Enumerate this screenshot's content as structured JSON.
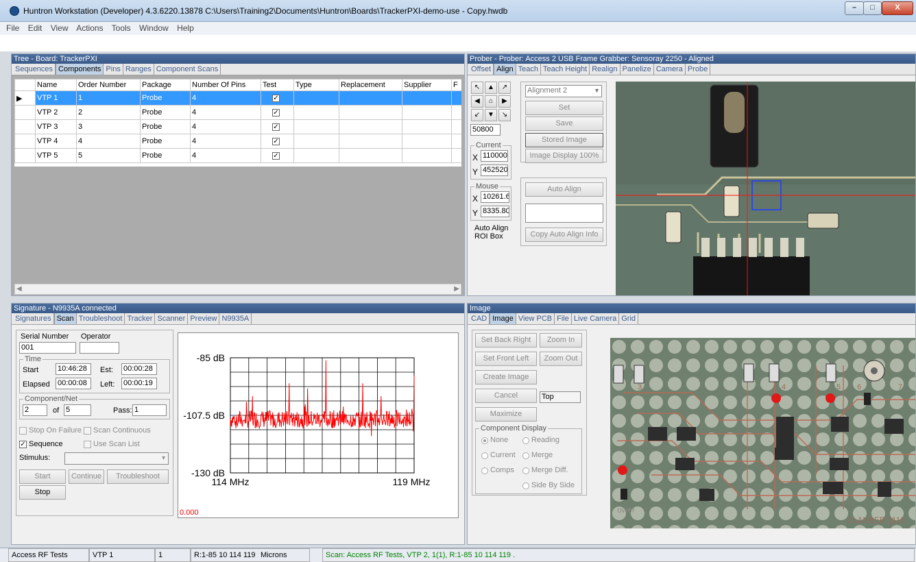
{
  "title": "Huntron Workstation (Developer) 4.3.6220.13878  C:\\Users\\Training2\\Documents\\Huntron\\Boards\\TrackerPXI-demo-use - Copy.hwdb",
  "window_buttons": {
    "minimize": "–",
    "maximize": "□",
    "close": "X"
  },
  "menu": [
    "File",
    "Edit",
    "View",
    "Actions",
    "Tools",
    "Window",
    "Help"
  ],
  "tree": {
    "title": "Tree - Board: TrackerPXI",
    "tabs": [
      "Sequences",
      "Components",
      "Pins",
      "Ranges",
      "Component Scans"
    ],
    "active_tab": 1,
    "columns": [
      "Name",
      "Order Number",
      "Package",
      "Number Of Pins",
      "Test",
      "Type",
      "Replacement",
      "Supplier",
      "F"
    ],
    "rows": [
      {
        "name": "VTP 1",
        "order": "1",
        "package": "Probe",
        "pins": "4",
        "test": true,
        "selected": true
      },
      {
        "name": "VTP 2",
        "order": "2",
        "package": "Probe",
        "pins": "4",
        "test": true
      },
      {
        "name": "VTP 3",
        "order": "3",
        "package": "Probe",
        "pins": "4",
        "test": true
      },
      {
        "name": "VTP 4",
        "order": "4",
        "package": "Probe",
        "pins": "4",
        "test": true
      },
      {
        "name": "VTP 5",
        "order": "5",
        "package": "Probe",
        "pins": "4",
        "test": true
      }
    ]
  },
  "prober": {
    "title": "Prober - Prober: Access 2 USB Frame Grabber: Sensoray 2250 - Aligned",
    "tabs": [
      "Offset",
      "Align",
      "Teach",
      "Teach Height",
      "Realign",
      "Panelize",
      "Camera",
      "Probe"
    ],
    "active_tab": 1,
    "step": "50800",
    "current_label": "Current",
    "current_x": "110000",
    "current_y": "452520",
    "mouse_label": "Mouse",
    "mouse_x": "10261.6",
    "mouse_y": "8335.803",
    "roi_label": "Auto Align ROI Box",
    "alignment": "Alignment 2",
    "buttons": {
      "set": "Set",
      "save": "Save",
      "stored_image": "Stored Image",
      "image_display": "Image Display 100%",
      "auto_align": "Auto Align",
      "copy_auto_align": "Copy Auto Align Info"
    }
  },
  "signature": {
    "title": "Signature - N9935A connected",
    "tabs": [
      "Signatures",
      "Scan",
      "Troubleshoot",
      "Tracker",
      "Scanner",
      "Preview",
      "N9935A"
    ],
    "active_tab": 1,
    "serial_label": "Serial Number",
    "serial": "001",
    "operator_label": "Operator",
    "operator": "",
    "time_label": "Time",
    "start_label": "Start",
    "start": "10:46:28",
    "est_label": "Est:",
    "est": "00:00:28",
    "elapsed_label": "Elapsed",
    "elapsed": "00:00:08",
    "left_label": "Left:",
    "left": "00:00:19",
    "component_label": "Component/Net",
    "comp_index": "2",
    "of_label": "of",
    "comp_total": "5",
    "pass_label": "Pass:",
    "pass": "1",
    "stop_on_failure": "Stop On Failure",
    "scan_continuous": "Scan Continuous",
    "sequence": "Sequence",
    "use_scan_list": "Use Scan List",
    "stimulus_label": "Stimulus:",
    "buttons": {
      "start": "Start",
      "continue": "Continue",
      "troubleshoot": "Troubleshoot",
      "stop": "Stop"
    },
    "readout": "0.000"
  },
  "chart_data": {
    "type": "line",
    "ytick_labels": [
      "-85 dB",
      "-107.5 dB",
      "-130 dB"
    ],
    "xtick_labels": [
      "114 MHz",
      "119 MHz"
    ],
    "x_range": [
      114,
      119
    ],
    "y_range": [
      -130,
      -85
    ],
    "grid": true,
    "series": [
      {
        "color": "#ff0000",
        "noise_floor_db": -109,
        "peaks": [
          {
            "x": 114.6,
            "y": -100
          },
          {
            "x": 115.6,
            "y": -95
          },
          {
            "x": 116.1,
            "y": -97
          },
          {
            "x": 116.6,
            "y": -86
          },
          {
            "x": 117.6,
            "y": -95
          },
          {
            "x": 118.1,
            "y": -100
          },
          {
            "x": 119.0,
            "y": -92
          }
        ]
      }
    ]
  },
  "image_pane": {
    "title": "Image",
    "tabs": [
      "CAD",
      "Image",
      "View PCB",
      "File",
      "Live Camera",
      "Grid"
    ],
    "active_tab": 1,
    "buttons": {
      "set_back_right": "Set Back Right",
      "zoom_in": "Zoom In",
      "set_front_left": "Set Front Left",
      "zoom_out": "Zoom Out",
      "create_image": "Create Image",
      "cancel": "Cancel",
      "maximize": "Maximize"
    },
    "side": "Top",
    "display_label": "Component Display",
    "radios": [
      "None",
      "Reading",
      "Current",
      "Merge",
      "Comps",
      "Merge Diff.",
      "Side By Side"
    ],
    "pcb_texts": [
      "3",
      "4",
      "5",
      "6",
      "7",
      "ower",
      "CLANBER 1110"
    ]
  },
  "status": {
    "sequence": "Access RF Tests",
    "component": "VTP 1",
    "index": "1",
    "range": "R:1-85 10 114 119",
    "units": "Microns",
    "message": "Scan: Access RF Tests, VTP 2, 1(1), R:1-85 10 114 119 ."
  },
  "colors": {
    "title_bar": "#3a5a88",
    "selected_row": "#3399ff",
    "trace": "#ff0000",
    "status_message": "#008000"
  }
}
